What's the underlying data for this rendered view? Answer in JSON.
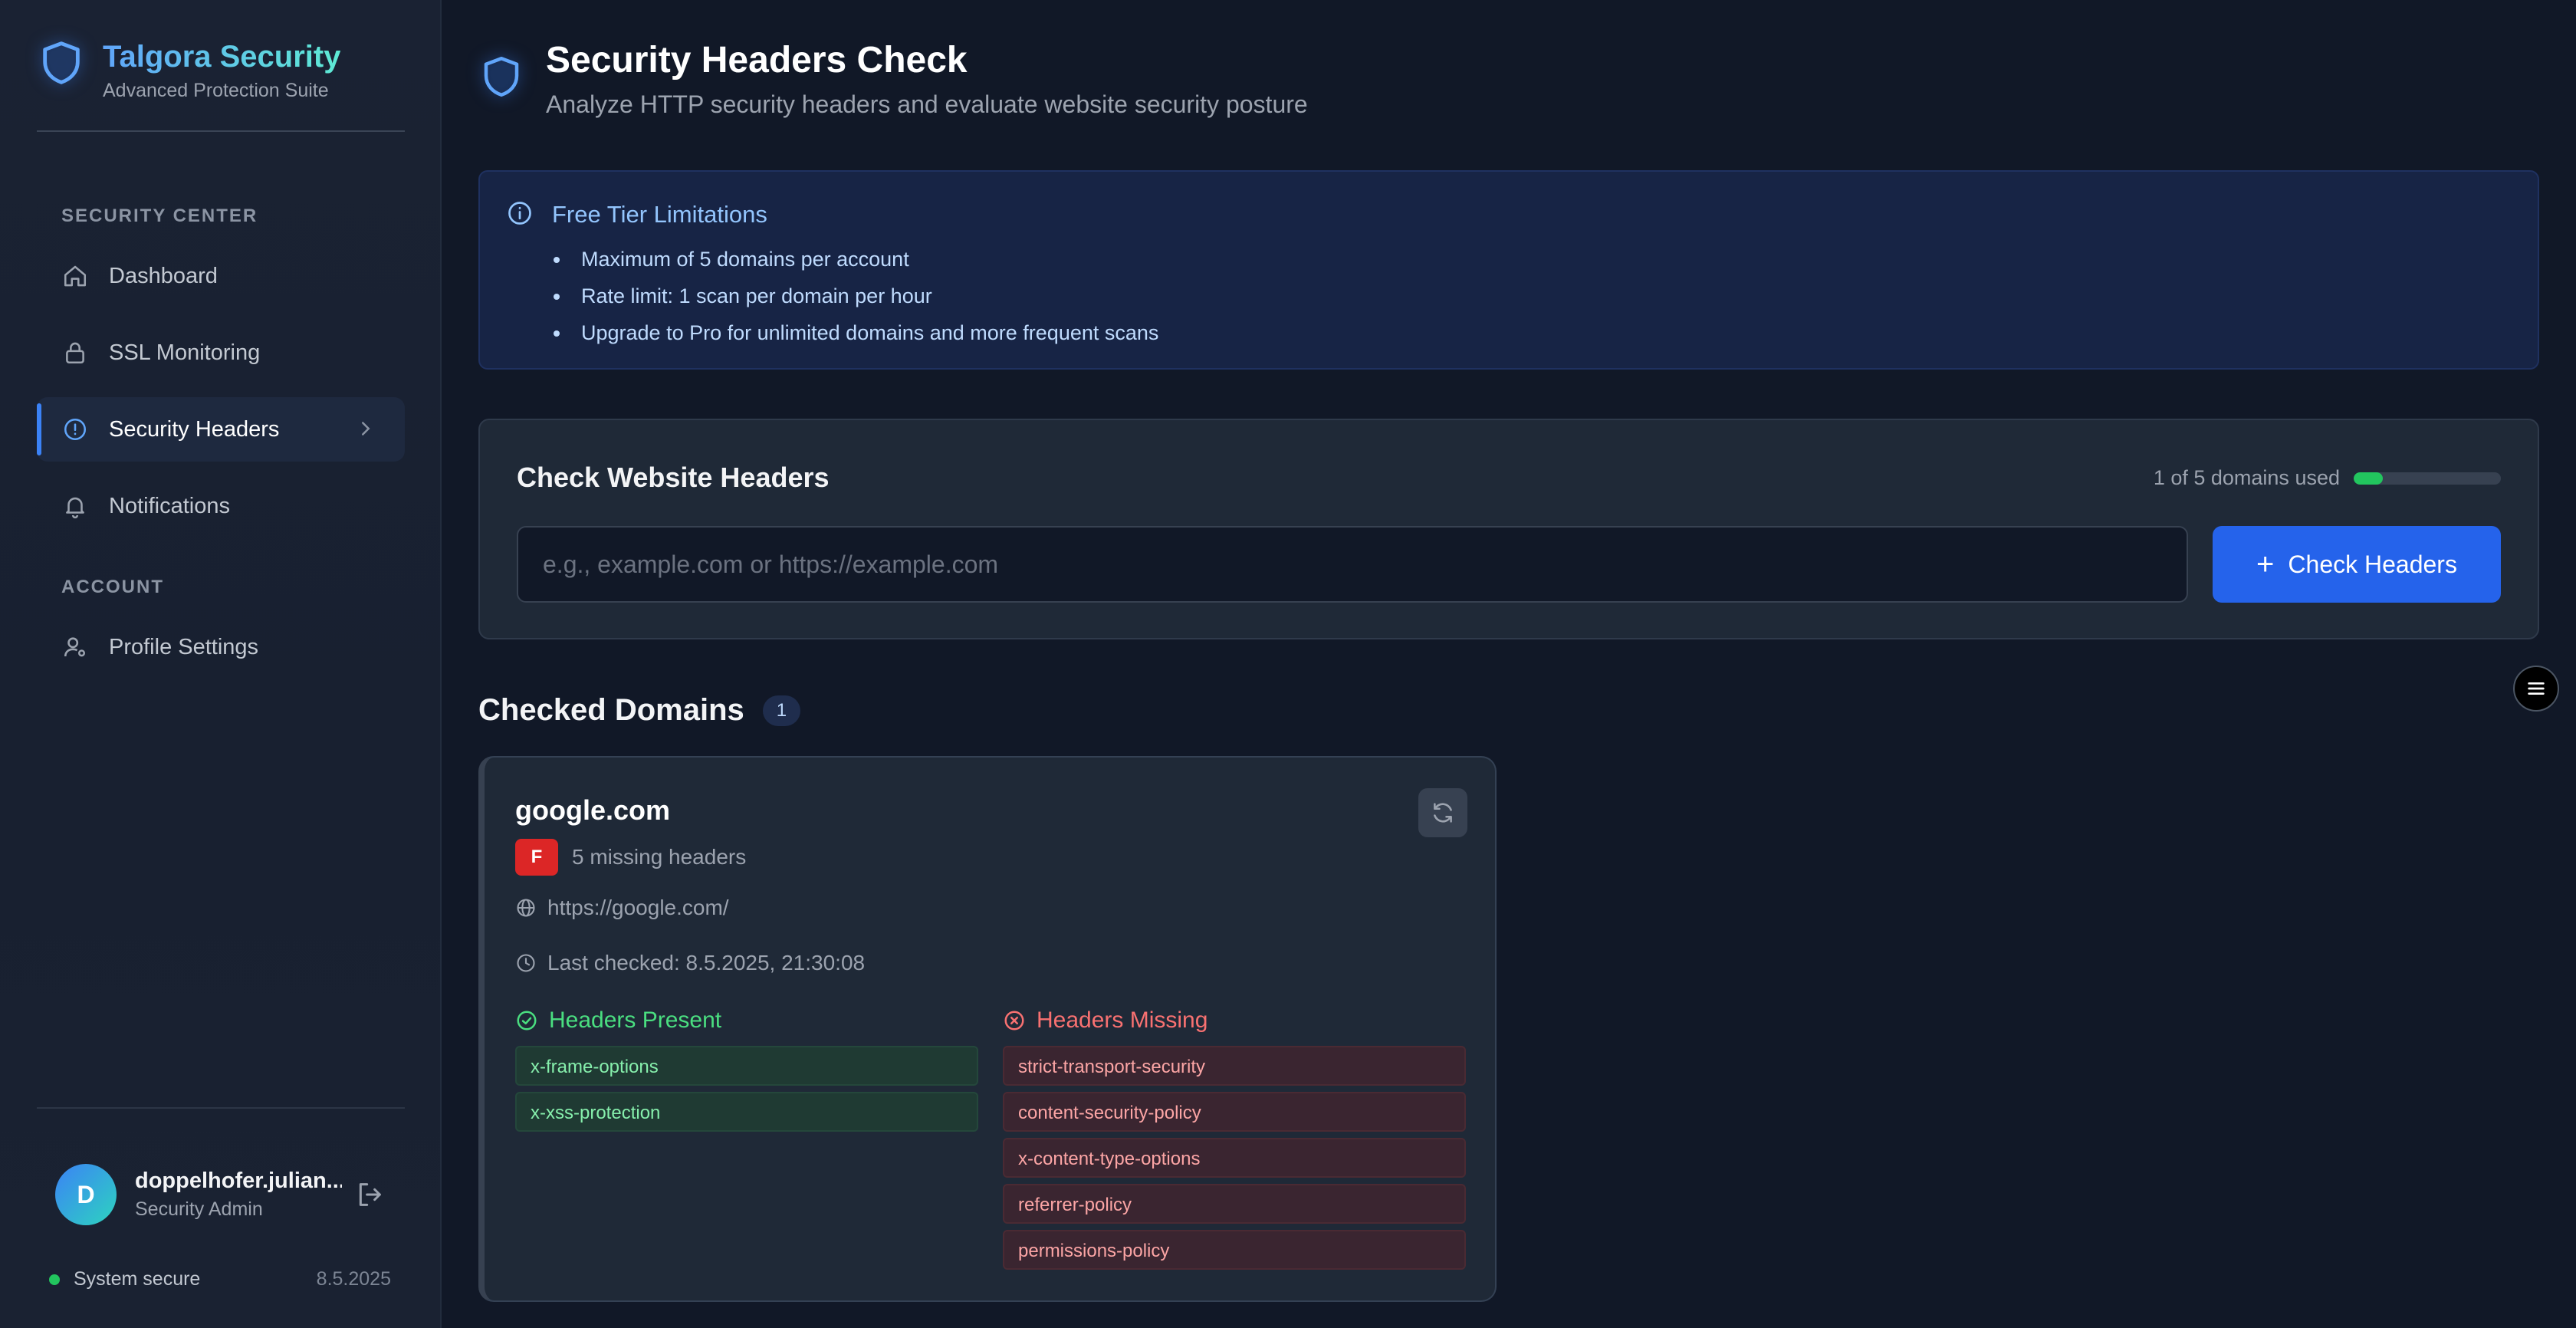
{
  "brand": {
    "title": "Talgora Security",
    "subtitle": "Advanced Protection Suite"
  },
  "sidebar": {
    "sections": [
      {
        "label": "SECURITY CENTER"
      },
      {
        "label": "ACCOUNT"
      }
    ],
    "items": [
      {
        "label": "Dashboard",
        "icon": "home-icon"
      },
      {
        "label": "SSL Monitoring",
        "icon": "lock-icon"
      },
      {
        "label": "Security Headers",
        "icon": "alert-circle-icon",
        "active": true
      },
      {
        "label": "Notifications",
        "icon": "bell-icon"
      },
      {
        "label": "Profile Settings",
        "icon": "user-settings-icon"
      }
    ],
    "user": {
      "initial": "D",
      "name": "doppelhofer.julian...",
      "role": "Security Admin"
    },
    "status": {
      "text": "System secure",
      "date": "8.5.2025",
      "color": "#22c55e"
    }
  },
  "page": {
    "title": "Security Headers Check",
    "subtitle": "Analyze HTTP security headers and evaluate website security posture"
  },
  "info": {
    "title": "Free Tier Limitations",
    "items": [
      "Maximum of 5 domains per account",
      "Rate limit: 1 scan per domain per hour",
      "Upgrade to Pro for unlimited domains and more frequent scans"
    ]
  },
  "check": {
    "title": "Check Website Headers",
    "usage_text": "1 of 5 domains used",
    "usage_fraction": 0.2,
    "input_placeholder": "e.g., example.com or https://example.com",
    "input_value": "",
    "button_label": "Check Headers"
  },
  "domains": {
    "title": "Checked Domains",
    "count": "1",
    "cards": [
      {
        "name": "google.com",
        "grade": "F",
        "missing_text": "5 missing headers",
        "url": "https://google.com/",
        "last_checked": "Last checked: 8.5.2025, 21:30:08",
        "present_title": "Headers Present",
        "present": [
          "x-frame-options",
          "x-xss-protection"
        ],
        "missing_title": "Headers Missing",
        "missing": [
          "strict-transport-security",
          "content-security-policy",
          "x-content-type-options",
          "referrer-policy",
          "permissions-policy"
        ]
      }
    ]
  },
  "colors": {
    "accent": "#2563eb",
    "success": "#22c55e",
    "danger": "#dc2626"
  }
}
